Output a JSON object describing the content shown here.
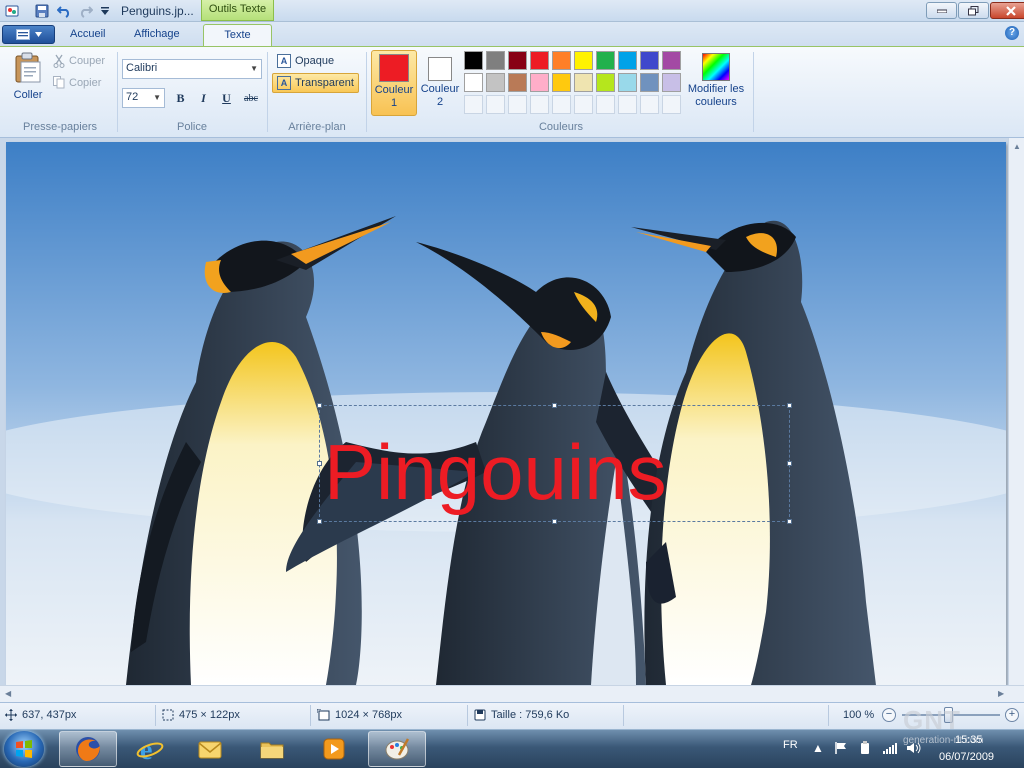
{
  "title_bar": {
    "document_title": "Penguins.jp...",
    "context_tab": "Outils Texte",
    "quick_access_icons": [
      "save-icon",
      "undo-icon",
      "redo-icon",
      "customize-icon"
    ]
  },
  "tabs": [
    {
      "label": "Accueil"
    },
    {
      "label": "Affichage"
    },
    {
      "label": "Texte",
      "active": true
    }
  ],
  "ribbon": {
    "clipboard": {
      "paste": "Coller",
      "cut": "Couper",
      "copy": "Copier",
      "group": "Presse-papiers"
    },
    "font": {
      "family": "Calibri",
      "size": "72",
      "bold": "B",
      "italic": "I",
      "underline": "U",
      "strikethrough": "abc",
      "group": "Police"
    },
    "background": {
      "opaque": "Opaque",
      "transparent": "Transparent",
      "selected": "Transparent",
      "group": "Arrière-plan"
    },
    "colors": {
      "color1_line1": "Couleur",
      "color1_line2": "1",
      "color2_line1": "Couleur",
      "color2_line2": "2",
      "color1_value": "#ed1c24",
      "color2_value": "#ffffff",
      "edit_line1": "Modifier les",
      "edit_line2": "couleurs",
      "group": "Couleurs",
      "palette": [
        "#000000",
        "#7f7f7f",
        "#880015",
        "#ed1c24",
        "#ff7f27",
        "#fff200",
        "#22b14c",
        "#00a2e8",
        "#3f48cc",
        "#a349a4",
        "#ffffff",
        "#c3c3c3",
        "#b97a57",
        "#ffaec9",
        "#ffc90e",
        "#efe4b0",
        "#b5e61d",
        "#99d9ea",
        "#7092be",
        "#c8bfe7",
        "",
        "",
        "",
        "",
        "",
        "",
        "",
        "",
        "",
        ""
      ]
    }
  },
  "canvas": {
    "text": "Pingouins",
    "text_color": "#ed1c24"
  },
  "status": {
    "cursor": "637, 437px",
    "selection": "475 × 122px",
    "image_size": "1024 × 768px",
    "file_size": "Taille : 759,6 Ko",
    "zoom": "100 %"
  },
  "taskbar": {
    "apps": [
      "firefox",
      "internet-explorer",
      "outlook",
      "explorer",
      "media-player",
      "paint"
    ],
    "active_app": "paint",
    "lang": "FR",
    "time": "15:35",
    "date": "06/07/2009"
  },
  "watermark": {
    "line1": "GNT",
    "line2": "generation-nt.com"
  }
}
